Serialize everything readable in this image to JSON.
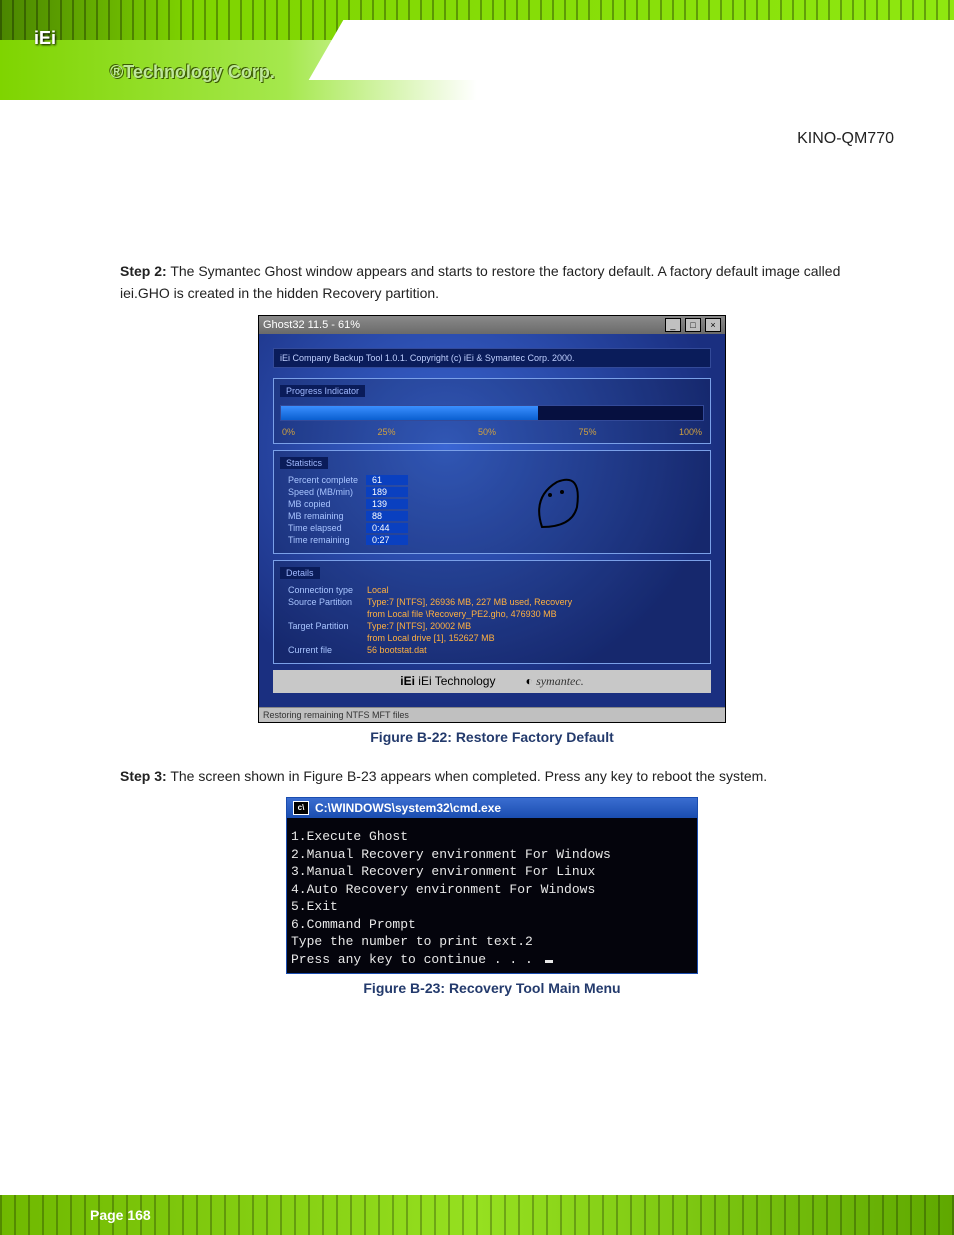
{
  "brand": {
    "logo": "iEi",
    "tagline": "®Technology Corp."
  },
  "product_name": "KINO-QM770",
  "steps": {
    "step2": {
      "label": "Step 2:",
      "text": "The Symantec Ghost window appears and starts to restore the factory default. A factory default image called iei.GHO is created in the hidden Recovery partition."
    },
    "step3": {
      "label": "Step 3:",
      "text": "The screen shown in Figure B-23 appears when completed. Press any key to reboot the system."
    }
  },
  "figure1": {
    "caption": "Figure B-22: Restore Factory Default",
    "title": "Ghost32 11.5 - 61%",
    "copyright": "iEi Company Backup Tool 1.0.1.  Copyright (c) iEi & Symantec Corp. 2000.",
    "progress_section": "Progress Indicator",
    "ticks": {
      "t0": "0%",
      "t25": "25%",
      "t50": "50%",
      "t75": "75%",
      "t100": "100%"
    },
    "stats_section": "Statistics",
    "stats": {
      "percent_complete_label": "Percent complete",
      "percent_complete": "61",
      "speed_label": "Speed (MB/min)",
      "speed": "189",
      "copied_label": "MB copied",
      "copied": "139",
      "remaining_label": "MB remaining",
      "remaining": "88",
      "elapsed_label": "Time elapsed",
      "elapsed": "0:44",
      "time_remaining_label": "Time remaining",
      "time_remaining": "0:27"
    },
    "details_section": "Details",
    "details": {
      "conn_label": "Connection type",
      "conn": "Local",
      "src_label": "Source Partition",
      "src1": "Type:7 [NTFS], 26936 MB, 227 MB used, Recovery",
      "src2": "from Local file \\Recovery_PE2.gho, 476930 MB",
      "tgt_label": "Target Partition",
      "tgt1": "Type:7 [NTFS], 20002 MB",
      "tgt2": "from Local drive [1], 152627 MB",
      "cur_label": "Current file",
      "cur": "56 bootstat.dat"
    },
    "brand_footer": {
      "iei": "iEi Technology",
      "symantec": "symantec."
    },
    "status": "Restoring remaining NTFS MFT files"
  },
  "figure2": {
    "caption": "Figure B-23: Recovery Tool Main Menu",
    "title": "C:\\WINDOWS\\system32\\cmd.exe",
    "lines": {
      "l1": "1.Execute Ghost",
      "l2": "2.Manual Recovery environment For Windows",
      "l3": "3.Manual Recovery environment For Linux",
      "l4": "4.Auto Recovery environment For Windows",
      "l5": "5.Exit",
      "l6": "6.Command Prompt",
      "l7": "Type the number to print text.2",
      "l8": "Press any key to continue . . . "
    }
  },
  "page_number": "Page 168"
}
